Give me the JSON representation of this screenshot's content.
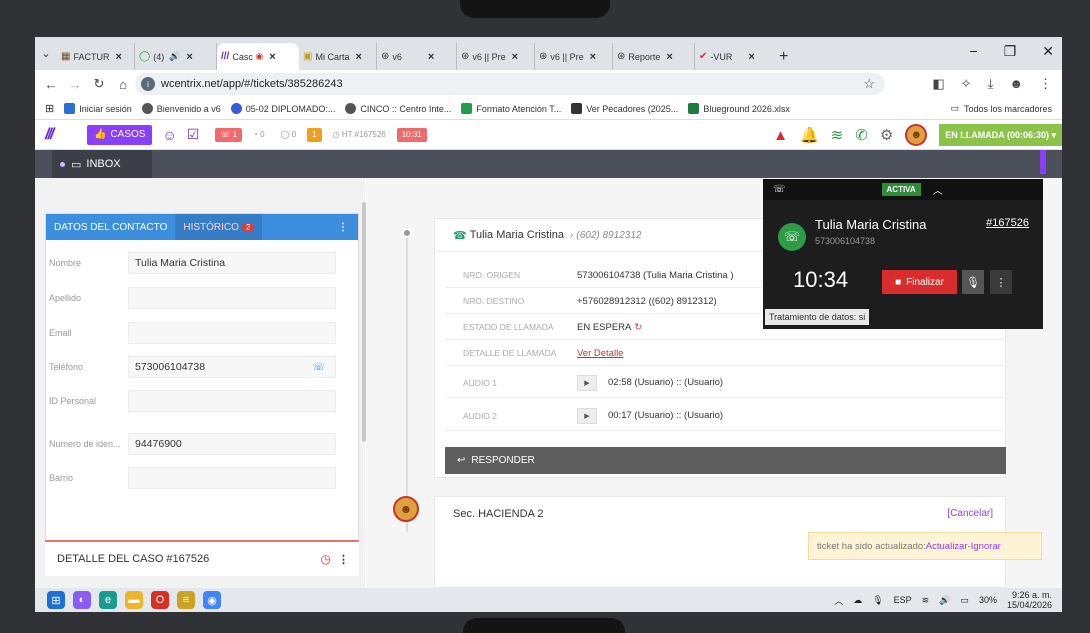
{
  "browser": {
    "tabs": [
      {
        "label": "FACTUR",
        "active": false
      },
      {
        "label": "(4) ​",
        "active": false
      },
      {
        "label": "Casc",
        "active": true
      },
      {
        "label": "Mi Carta",
        "active": false
      },
      {
        "label": "v6",
        "active": false
      },
      {
        "label": "v6 || Pre",
        "active": false
      },
      {
        "label": "v6 || Pre",
        "active": false
      },
      {
        "label": "Reporte",
        "active": false
      },
      {
        "label": "-VUR",
        "active": false
      }
    ],
    "url": "wcentrix.net/app/#/tickets/385286243",
    "bookmarks": [
      "Iniciar sesión",
      "Bienvenido a v6",
      "05-02 DIPLOMADO:...",
      "CINCO :: Centro Inte...",
      "Formato Atención T...",
      "Ver Pecadores (2025...",
      "Blueground 2026.xlsx"
    ],
    "all_bookmarks": "Todos los marcadores"
  },
  "app": {
    "casos_label": "CASOS",
    "chips": [
      "1",
      "0",
      "0",
      "1",
      "HT #167526",
      "10:31"
    ],
    "call_status": "EN LLAMADA (00:06:30)",
    "inbox_label": "INBOX"
  },
  "contact": {
    "tab_contact": "DATOS DEL CONTACTO",
    "tab_history": "HISTÓRICO",
    "history_count": "2",
    "fields": [
      {
        "label": "Nombre",
        "value": "Tulia Maria Cristina"
      },
      {
        "label": "Apellido",
        "value": ""
      },
      {
        "label": "Email",
        "value": ""
      },
      {
        "label": "Teléfono",
        "value": "573006104738"
      },
      {
        "label": "ID Personal",
        "value": ""
      },
      {
        "label": "Numero de iden...",
        "value": "94476900"
      },
      {
        "label": "Barrio",
        "value": ""
      }
    ],
    "case_detail": "DETALLE DEL CASO #167526"
  },
  "call_card": {
    "name": "Tulia Maria Cristina",
    "phone_sub": "(602) 8912312",
    "rows": [
      {
        "label": "NRO. ORIGEN",
        "value": "573006104738 (Tulia Maria Cristina )"
      },
      {
        "label": "NRO. DESTINO",
        "value": "+576028912312 ((602) 8912312)"
      },
      {
        "label": "ESTADO DE LLAMADA",
        "value": "EN ESPERA"
      },
      {
        "label": "DETALLE DE LLAMADA",
        "value": "Ver Detalle"
      },
      {
        "label": "AUDIO 1",
        "value": "02:58 (Usuario) :: (Usuario)"
      },
      {
        "label": "AUDIO 2",
        "value": "00:17 (Usuario) :: (Usuario)"
      }
    ],
    "reply_label": "RESPONDER"
  },
  "second_card": {
    "title": "Sec. HACIENDA 2",
    "cancel": "[Cancelar]"
  },
  "notification": {
    "text": "ticket ha sido actualizado: ",
    "update": "Actualizar",
    "sep": " - ",
    "ignore": "Ignorar"
  },
  "call_popup": {
    "status": "ACTIVA",
    "name": "Tulia Maria Cristina",
    "number": "573006104738",
    "ticket": "#167526",
    "timer": "10:34",
    "end_label": "Finalizar",
    "data_note": "Tratamiento de datos: si"
  },
  "taskbar": {
    "lang": "ESP",
    "battery": "30%",
    "time": "9:26 a. m.",
    "date": "15/04/2026"
  },
  "colors": {
    "accent": "#8a3ffc",
    "blue": "#3e8ee0",
    "active_green": "#2e8b3a",
    "end_red": "#d92c2c"
  }
}
